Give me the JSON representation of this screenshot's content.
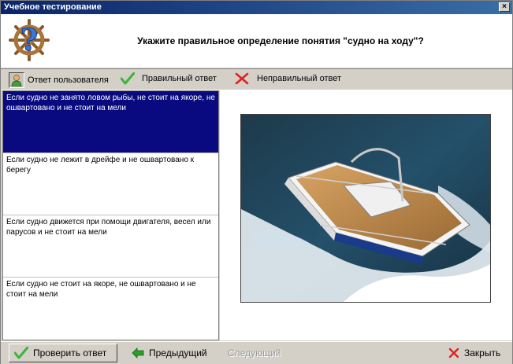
{
  "window": {
    "title": "Учебное тестирование",
    "close_glyph": "×"
  },
  "question": {
    "text": "Укажите правильное определение понятия \"судно на ходу\"?"
  },
  "legend": {
    "user_answer": "Ответ пользователя",
    "correct_answer": "Правильный ответ",
    "wrong_answer": "Неправильный ответ"
  },
  "answers": [
    {
      "text": "Если судно не занято ловом рыбы, не стоит на якоре, не ошвартовано и не стоит на мели",
      "selected": true
    },
    {
      "text": "Если судно не лежит в дрейфе и не ошвартовано к берегу",
      "selected": false
    },
    {
      "text": "Если судно движется при помощи двигателя, весел или парусов и не стоит на мели",
      "selected": false
    },
    {
      "text": "Если судно не стоит на якоре, не ошвартовано и не стоит на мели",
      "selected": false
    }
  ],
  "buttons": {
    "check": "Проверить ответ",
    "prev": "Предыдущий",
    "next": "Следующий",
    "close": "Закрыть"
  },
  "icons": {
    "logo": "ship-wheel-question-icon",
    "user": "user-icon",
    "correct": "green-check-icon",
    "wrong": "red-cross-icon",
    "prev": "green-arrow-left-icon",
    "close": "red-cross-icon"
  },
  "colors": {
    "title_bar": "#0a246a",
    "selected_answer": "#0a0a80",
    "check_green": "#3cb43c",
    "cross_red": "#e02020"
  }
}
